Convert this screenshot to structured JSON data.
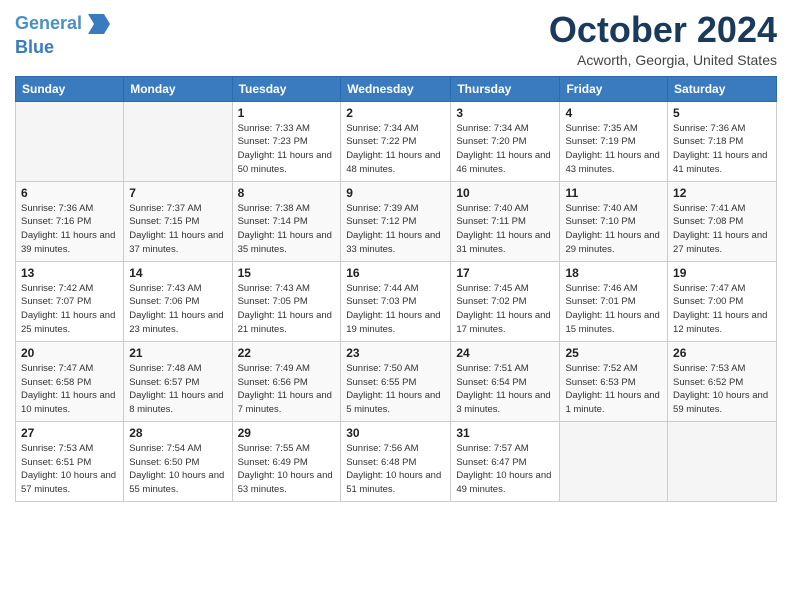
{
  "header": {
    "logo_line1": "General",
    "logo_line2": "Blue",
    "month": "October 2024",
    "location": "Acworth, Georgia, United States"
  },
  "days_of_week": [
    "Sunday",
    "Monday",
    "Tuesday",
    "Wednesday",
    "Thursday",
    "Friday",
    "Saturday"
  ],
  "weeks": [
    [
      {
        "day": "",
        "empty": true
      },
      {
        "day": "",
        "empty": true
      },
      {
        "day": "1",
        "sunrise": "7:33 AM",
        "sunset": "7:23 PM",
        "daylight": "11 hours and 50 minutes."
      },
      {
        "day": "2",
        "sunrise": "7:34 AM",
        "sunset": "7:22 PM",
        "daylight": "11 hours and 48 minutes."
      },
      {
        "day": "3",
        "sunrise": "7:34 AM",
        "sunset": "7:20 PM",
        "daylight": "11 hours and 46 minutes."
      },
      {
        "day": "4",
        "sunrise": "7:35 AM",
        "sunset": "7:19 PM",
        "daylight": "11 hours and 43 minutes."
      },
      {
        "day": "5",
        "sunrise": "7:36 AM",
        "sunset": "7:18 PM",
        "daylight": "11 hours and 41 minutes."
      }
    ],
    [
      {
        "day": "6",
        "sunrise": "7:36 AM",
        "sunset": "7:16 PM",
        "daylight": "11 hours and 39 minutes."
      },
      {
        "day": "7",
        "sunrise": "7:37 AM",
        "sunset": "7:15 PM",
        "daylight": "11 hours and 37 minutes."
      },
      {
        "day": "8",
        "sunrise": "7:38 AM",
        "sunset": "7:14 PM",
        "daylight": "11 hours and 35 minutes."
      },
      {
        "day": "9",
        "sunrise": "7:39 AM",
        "sunset": "7:12 PM",
        "daylight": "11 hours and 33 minutes."
      },
      {
        "day": "10",
        "sunrise": "7:40 AM",
        "sunset": "7:11 PM",
        "daylight": "11 hours and 31 minutes."
      },
      {
        "day": "11",
        "sunrise": "7:40 AM",
        "sunset": "7:10 PM",
        "daylight": "11 hours and 29 minutes."
      },
      {
        "day": "12",
        "sunrise": "7:41 AM",
        "sunset": "7:08 PM",
        "daylight": "11 hours and 27 minutes."
      }
    ],
    [
      {
        "day": "13",
        "sunrise": "7:42 AM",
        "sunset": "7:07 PM",
        "daylight": "11 hours and 25 minutes."
      },
      {
        "day": "14",
        "sunrise": "7:43 AM",
        "sunset": "7:06 PM",
        "daylight": "11 hours and 23 minutes."
      },
      {
        "day": "15",
        "sunrise": "7:43 AM",
        "sunset": "7:05 PM",
        "daylight": "11 hours and 21 minutes."
      },
      {
        "day": "16",
        "sunrise": "7:44 AM",
        "sunset": "7:03 PM",
        "daylight": "11 hours and 19 minutes."
      },
      {
        "day": "17",
        "sunrise": "7:45 AM",
        "sunset": "7:02 PM",
        "daylight": "11 hours and 17 minutes."
      },
      {
        "day": "18",
        "sunrise": "7:46 AM",
        "sunset": "7:01 PM",
        "daylight": "11 hours and 15 minutes."
      },
      {
        "day": "19",
        "sunrise": "7:47 AM",
        "sunset": "7:00 PM",
        "daylight": "11 hours and 12 minutes."
      }
    ],
    [
      {
        "day": "20",
        "sunrise": "7:47 AM",
        "sunset": "6:58 PM",
        "daylight": "11 hours and 10 minutes."
      },
      {
        "day": "21",
        "sunrise": "7:48 AM",
        "sunset": "6:57 PM",
        "daylight": "11 hours and 8 minutes."
      },
      {
        "day": "22",
        "sunrise": "7:49 AM",
        "sunset": "6:56 PM",
        "daylight": "11 hours and 7 minutes."
      },
      {
        "day": "23",
        "sunrise": "7:50 AM",
        "sunset": "6:55 PM",
        "daylight": "11 hours and 5 minutes."
      },
      {
        "day": "24",
        "sunrise": "7:51 AM",
        "sunset": "6:54 PM",
        "daylight": "11 hours and 3 minutes."
      },
      {
        "day": "25",
        "sunrise": "7:52 AM",
        "sunset": "6:53 PM",
        "daylight": "11 hours and 1 minute."
      },
      {
        "day": "26",
        "sunrise": "7:53 AM",
        "sunset": "6:52 PM",
        "daylight": "10 hours and 59 minutes."
      }
    ],
    [
      {
        "day": "27",
        "sunrise": "7:53 AM",
        "sunset": "6:51 PM",
        "daylight": "10 hours and 57 minutes."
      },
      {
        "day": "28",
        "sunrise": "7:54 AM",
        "sunset": "6:50 PM",
        "daylight": "10 hours and 55 minutes."
      },
      {
        "day": "29",
        "sunrise": "7:55 AM",
        "sunset": "6:49 PM",
        "daylight": "10 hours and 53 minutes."
      },
      {
        "day": "30",
        "sunrise": "7:56 AM",
        "sunset": "6:48 PM",
        "daylight": "10 hours and 51 minutes."
      },
      {
        "day": "31",
        "sunrise": "7:57 AM",
        "sunset": "6:47 PM",
        "daylight": "10 hours and 49 minutes."
      },
      {
        "day": "",
        "empty": true
      },
      {
        "day": "",
        "empty": true
      }
    ]
  ],
  "labels": {
    "sunrise": "Sunrise:",
    "sunset": "Sunset:",
    "daylight": "Daylight:"
  }
}
